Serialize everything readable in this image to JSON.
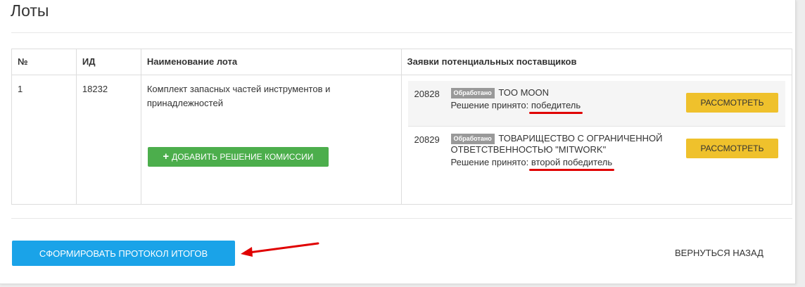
{
  "page": {
    "title": "Лоты"
  },
  "table": {
    "headers": {
      "num": "№",
      "id": "ИД",
      "name": "Наименование лота",
      "bids": "Заявки потенциальных поставщиков"
    },
    "rows": [
      {
        "num": "1",
        "id": "18232",
        "name": "Комплект запасных частей инструментов и принадлежностей",
        "add_button_label": "ДОБАВИТЬ РЕШЕНИЕ КОМИССИИ",
        "bids": [
          {
            "id": "20828",
            "badge": "Обработано",
            "supplier": "ТОО MOON",
            "decision_prefix": "Решение принято:",
            "decision": "победитель",
            "review_label": "РАССМОТРЕТЬ"
          },
          {
            "id": "20829",
            "badge": "Обработано",
            "supplier": "ТОВАРИЩЕСТВО С ОГРАНИЧЕННОЙ ОТВЕТСТВЕННОСТЬЮ \"MITWORK\"",
            "decision_prefix": "Решение принято:",
            "decision": "второй победитель",
            "review_label": "РАССМОТРЕТЬ"
          }
        ]
      }
    ]
  },
  "footer": {
    "form_protocol_label": "СФОРМИРОВАТЬ ПРОТОКОЛ ИТОГОВ",
    "back_label": "ВЕРНУТЬСЯ НАЗАД"
  },
  "colors": {
    "green_button": "#4cae4c",
    "yellow_button": "#efc12c",
    "blue_button": "#1aa3e8",
    "badge_gray": "#999999",
    "annotation_red": "#e00000"
  },
  "icons": {
    "add": "plus-icon"
  }
}
